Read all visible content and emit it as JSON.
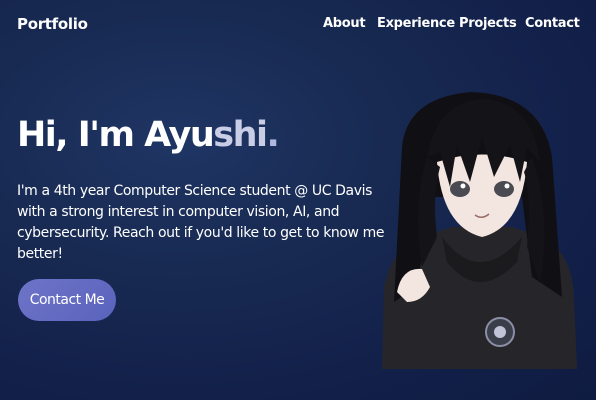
{
  "navbar": {
    "brand": "Portfolio",
    "links": [
      "About",
      "Experience",
      "Projects",
      "Contact"
    ]
  },
  "hero": {
    "title_prefix": "Hi, I'm Ayu",
    "title_highlight": "shi",
    "title_dot": ".",
    "description": "I'm a 4th year Computer Science student @ UC Davis with a strong interest in computer vision, AI, and cybersecurity. Reach out if you'd like to get to know me better!",
    "cta_label": "Contact Me"
  },
  "colors": {
    "background": "#182a52",
    "button": "#636bc2",
    "text": "#ffffff"
  },
  "portrait": {
    "description_icon": "anime-portrait-illustration"
  }
}
